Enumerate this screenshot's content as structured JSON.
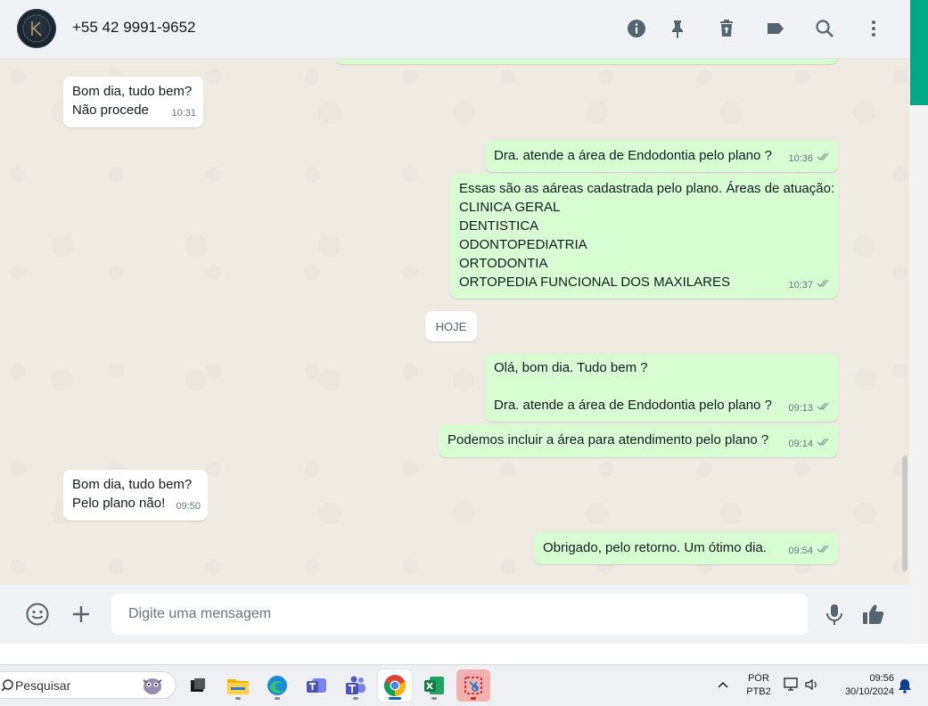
{
  "header": {
    "contact_name": "+55 42 9991-9652",
    "icons": [
      "info-icon",
      "pin-icon",
      "delete-icon",
      "label-icon",
      "search-icon",
      "more-menu-icon"
    ]
  },
  "messages": [
    {
      "direction": "in",
      "lines": "Bom dia, tudo bem?\nNão procede",
      "time": "10:31"
    },
    {
      "direction": "out",
      "lines": "Dra. atende a área de Endodontia pelo plano ?",
      "time": "10:36",
      "status": "read"
    },
    {
      "direction": "out",
      "lines": "Essas são as aáreas cadastrada pelo plano. Áreas de atuação:\nCLINICA GERAL\nDENTISTICA\nODONTOPEDIATRIA\nORTODONTIA\nORTOPEDIA FUNCIONAL DOS MAXILARES",
      "time": "10:37",
      "status": "read"
    },
    {
      "direction": "out",
      "lines": "Olá, bom dia. Tudo bem ?\n\nDra. atende a área de Endodontia pelo plano ?",
      "time": "09:13",
      "status": "read"
    },
    {
      "direction": "out",
      "lines": "Podemos incluir a área para atendimento pelo plano ?",
      "time": "09:14",
      "status": "read"
    },
    {
      "direction": "in",
      "lines": "Bom dia, tudo bem?\nPelo plano não!",
      "time": "09:50"
    },
    {
      "direction": "out",
      "lines": "Obrigado, pelo retorno. Um ótimo dia.",
      "time": "09:54",
      "status": "read"
    }
  ],
  "day_divider": "HOJE",
  "composer": {
    "placeholder": "Digite uma mensagem",
    "value": ""
  },
  "taskbar": {
    "search_label": "Pesquisar",
    "apps": [
      "task-view",
      "file-explorer",
      "edge",
      "teams-classic",
      "teams",
      "chrome",
      "excel",
      "snipping-tool"
    ],
    "active_app": "chrome",
    "language": "POR",
    "keyboard": "PTB2",
    "time": "09:56",
    "date": "30/10/2024"
  },
  "colors": {
    "outgoing_bubble": "#d9fdd3",
    "incoming_bubble": "#ffffff",
    "chat_background": "#efeae2",
    "read_tick": "#8696a0",
    "accent": "#00a884"
  }
}
